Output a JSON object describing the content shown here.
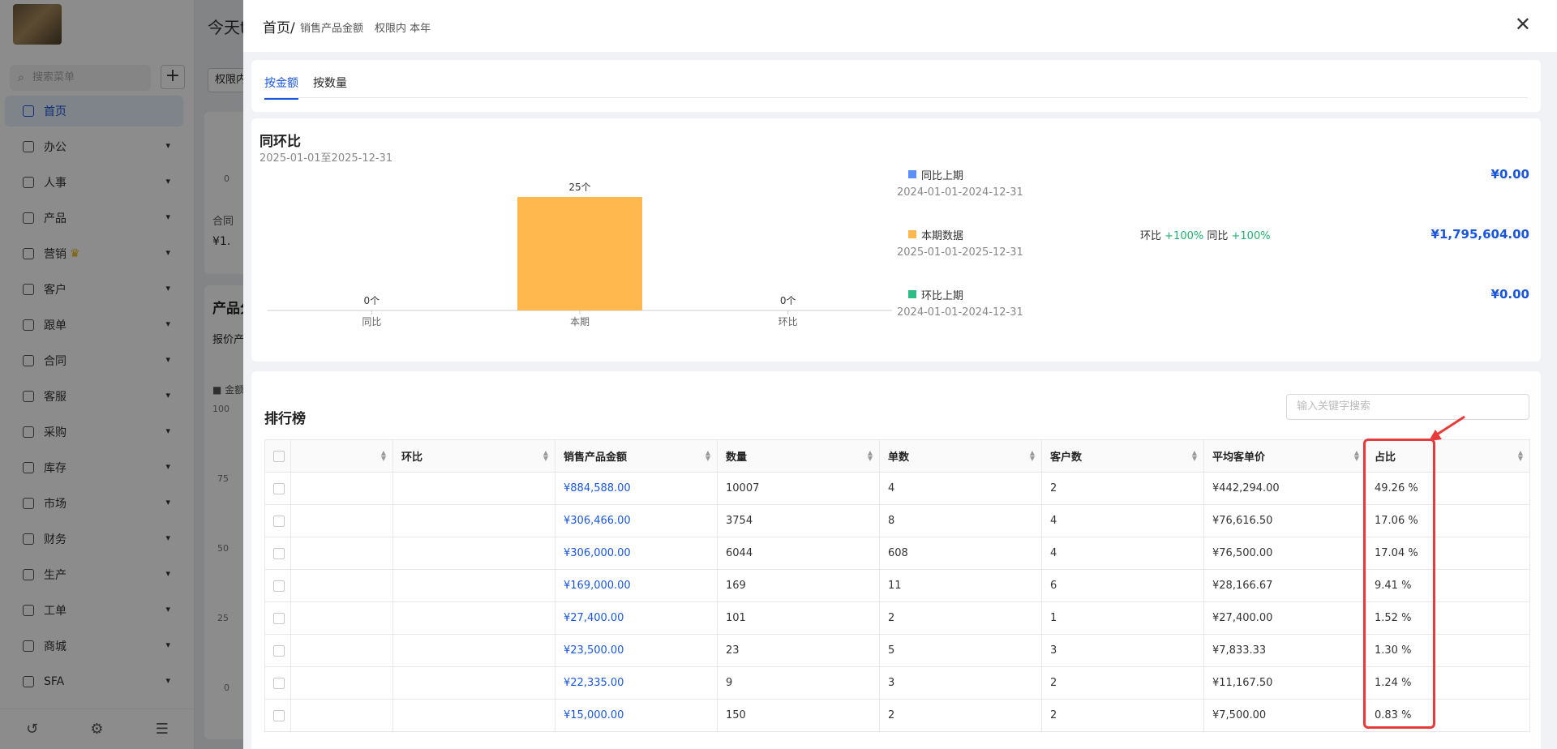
{
  "sidebar": {
    "search_placeholder": "搜索菜单",
    "items": [
      {
        "label": "首页",
        "active": true
      },
      {
        "label": "办公"
      },
      {
        "label": "人事"
      },
      {
        "label": "产品"
      },
      {
        "label": "营销"
      },
      {
        "label": "客户"
      },
      {
        "label": "跟单"
      },
      {
        "label": "合同"
      },
      {
        "label": "客服"
      },
      {
        "label": "采购"
      },
      {
        "label": "库存"
      },
      {
        "label": "市场"
      },
      {
        "label": "财务"
      },
      {
        "label": "生产"
      },
      {
        "label": "工单"
      },
      {
        "label": "商城"
      },
      {
        "label": "SFA"
      }
    ]
  },
  "background": {
    "title": "今天t",
    "tag": "权限内",
    "card_label": "合同",
    "card_value": "¥1.",
    "section_title": "产品分",
    "section_sub": "报价产",
    "legend": "■ 金额",
    "axis": [
      "0",
      "100",
      "75",
      "50",
      "25",
      "0"
    ]
  },
  "drawer": {
    "title": "首页/",
    "subtitle1": "销售产品金额",
    "subtitle2": "权限内 本年",
    "tabs": [
      "按金额",
      "按数量"
    ],
    "yoy": {
      "title": "同环比",
      "range": "2025-01-01至2025-12-31",
      "legend": [
        {
          "name": "同比上期",
          "date": "2024-01-01-2024-12-31",
          "value": "¥0.00",
          "color": "#5b8ff9"
        },
        {
          "name": "本期数据",
          "date": "2025-01-01-2025-12-31",
          "value": "¥1,795,604.00",
          "color": "#ffb84d",
          "ratio1_label": "环比",
          "ratio1_value": "+100%",
          "ratio2_label": "同比",
          "ratio2_value": "+100%"
        },
        {
          "name": "环比上期",
          "date": "2024-01-01-2024-12-31",
          "value": "¥0.00",
          "color": "#2ebd85"
        }
      ]
    },
    "rank": {
      "title": "排行榜",
      "search_placeholder": "输入关键字搜索",
      "columns": [
        "",
        "环比",
        "销售产品金额",
        "数量",
        "单数",
        "客户数",
        "平均客单价",
        "占比"
      ],
      "rows": [
        [
          "",
          "",
          "¥884,588.00",
          "10007",
          "4",
          "2",
          "¥442,294.00",
          "49.26 %"
        ],
        [
          "",
          "",
          "¥306,466.00",
          "3754",
          "8",
          "4",
          "¥76,616.50",
          "17.06 %"
        ],
        [
          "",
          "",
          "¥306,000.00",
          "6044",
          "608",
          "4",
          "¥76,500.00",
          "17.04 %"
        ],
        [
          "",
          "",
          "¥169,000.00",
          "169",
          "11",
          "6",
          "¥28,166.67",
          "9.41 %"
        ],
        [
          "",
          "",
          "¥27,400.00",
          "101",
          "2",
          "1",
          "¥27,400.00",
          "1.52 %"
        ],
        [
          "",
          "",
          "¥23,500.00",
          "23",
          "5",
          "3",
          "¥7,833.33",
          "1.30 %"
        ],
        [
          "",
          "",
          "¥22,335.00",
          "9",
          "3",
          "2",
          "¥11,167.50",
          "1.24 %"
        ],
        [
          "",
          "",
          "¥15,000.00",
          "150",
          "2",
          "2",
          "¥7,500.00",
          "0.83 %"
        ]
      ]
    }
  },
  "chart_data": {
    "type": "bar",
    "categories": [
      "同比",
      "本期",
      "环比"
    ],
    "values": [
      0,
      25
    ],
    "value_labels": [
      "0个",
      "25个",
      "0个"
    ],
    "colors": [
      "#5b8ff9",
      "#ffb84d",
      "#2ebd85"
    ],
    "series_values": [
      0,
      25,
      0
    ]
  }
}
